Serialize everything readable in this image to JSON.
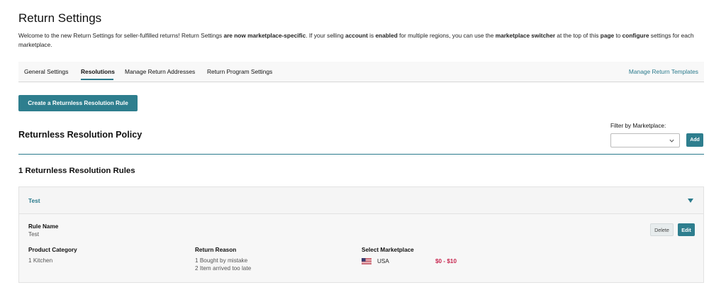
{
  "page": {
    "title": "Return Settings",
    "intro_parts": [
      "Welcome to the new Return Settings for seller-fulfilled returns! Return Settings ",
      "are now marketplace-specific",
      ". If your selling ",
      "account",
      " is ",
      "enabled",
      " for multiple regions, you can use the ",
      "marketplace switcher",
      " at the top of this ",
      "page",
      " to ",
      "configure",
      " settings for each marketplace."
    ]
  },
  "tabs": {
    "items": [
      {
        "label": "General Settings"
      },
      {
        "label": "Resolutions"
      },
      {
        "label": "Manage Return Addresses"
      },
      {
        "label": "Return Program Settings"
      }
    ],
    "active_index": 1,
    "right_link": "Manage Return Templates"
  },
  "actions": {
    "create_rule_label": "Create a Returnless Resolution Rule"
  },
  "policy": {
    "title": "Returnless Resolution Policy",
    "filter_label": "Filter by Marketplace:",
    "filter_value": "",
    "add_label": "Add"
  },
  "rules": {
    "count_label": "1 Returnless Resolution Rules",
    "items": [
      {
        "header": "Test",
        "rule_name_label": "Rule Name",
        "rule_name": "Test",
        "product_category_label": "Product Category",
        "product_category": "1 Kitchen",
        "return_reason_label": "Return Reason",
        "return_reasons": [
          "1 Bought by mistake",
          "2 Item arrived too late"
        ],
        "marketplace_label": "Select Marketplace",
        "marketplace": "USA",
        "price_range": "$0 - $10",
        "delete_label": "Delete",
        "edit_label": "Edit"
      }
    ]
  },
  "colors": {
    "accent": "#2e7e8e",
    "link": "#2a7a8c",
    "price": "#c7254e"
  },
  "icons": {
    "dropdown": "chevron-down-icon",
    "collapse": "caret-down-icon",
    "flag": "us-flag-icon"
  }
}
